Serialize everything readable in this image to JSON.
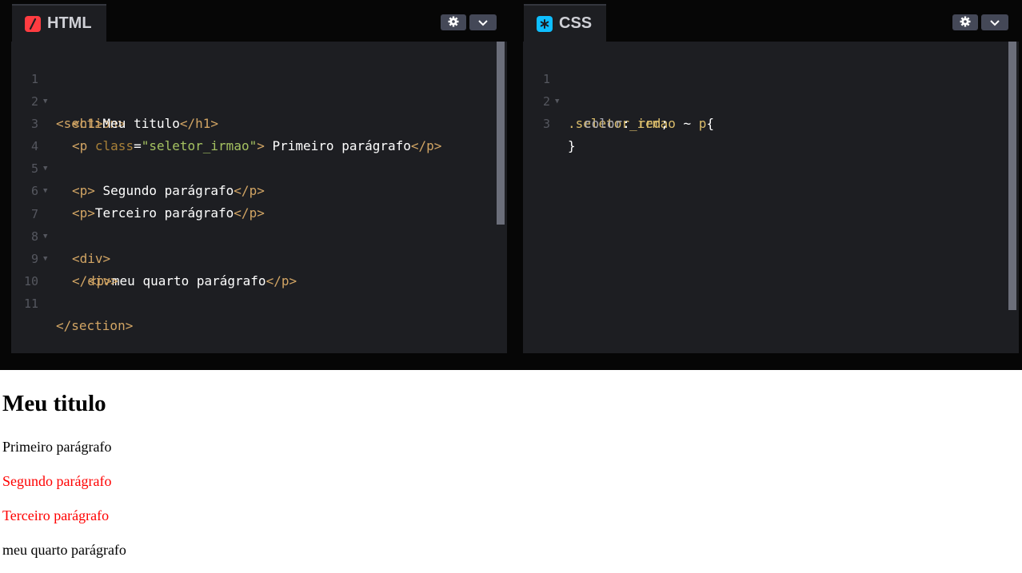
{
  "html_panel": {
    "tab_label": "HTML",
    "icon": "html-slash-icon",
    "lines": [
      {
        "num": "1",
        "fold": true
      },
      {
        "num": "2",
        "fold": false
      },
      {
        "num": "3",
        "fold": false
      },
      {
        "num": "4",
        "fold": true
      },
      {
        "num": "5",
        "fold": true
      },
      {
        "num": "6",
        "fold": false
      },
      {
        "num": "7",
        "fold": true
      },
      {
        "num": "8",
        "fold": true
      },
      {
        "num": "9",
        "fold": false
      },
      {
        "num": "10",
        "fold": false
      },
      {
        "num": "11",
        "fold": false
      }
    ],
    "code": {
      "l1_open": "<section>",
      "l2_open": "<h1>",
      "l2_text": "Meu titulo",
      "l2_close": "</h1>",
      "l3_open": "<p ",
      "l3_attr": "class",
      "l3_eq": "=",
      "l3_value": "\"seletor_irmao\"",
      "l3_gt": ">",
      "l3_text": " Primeiro parágrafo",
      "l3_close": "</p>",
      "l4_open": "<p>",
      "l4_text": " Segundo parágrafo",
      "l4_close": "</p>",
      "l5_open": "<p>",
      "l5_text": "Terceiro parágrafo",
      "l5_close": "</p>",
      "l7_open": "<div>",
      "l8_open": "<p>",
      "l8_text": "meu quarto parágrafo",
      "l8_close": "</p>",
      "l9_close": "</div>",
      "l11_close": "</section>"
    }
  },
  "css_panel": {
    "tab_label": "CSS",
    "icon": "css-asterisk-icon",
    "lines": [
      {
        "num": "1",
        "fold": true
      },
      {
        "num": "2",
        "fold": false
      },
      {
        "num": "3",
        "fold": false
      }
    ],
    "code": {
      "l1_selector": ".seletor_irmao",
      "l1_combinator": " ~ ",
      "l1_element": "p",
      "l1_brace": "{",
      "l2_prop": "color",
      "l2_colon": ": ",
      "l2_value": "red",
      "l2_semi": ";",
      "l3_brace": "}"
    }
  },
  "preview": {
    "heading": "Meu titulo",
    "paragraphs": [
      {
        "text": "Primeiro parágrafo",
        "color": "#000000"
      },
      {
        "text": "Segundo parágrafo",
        "color": "#ff0000"
      },
      {
        "text": "Terceiro parágrafo",
        "color": "#ff0000"
      },
      {
        "text": "meu quarto parágrafo",
        "color": "#000000"
      }
    ]
  },
  "colors": {
    "html_icon": "#ff3c41",
    "css_icon": "#0ebeff",
    "editor_bg": "#1d1e22",
    "tag": "#d2a564",
    "string": "#a5c261"
  }
}
